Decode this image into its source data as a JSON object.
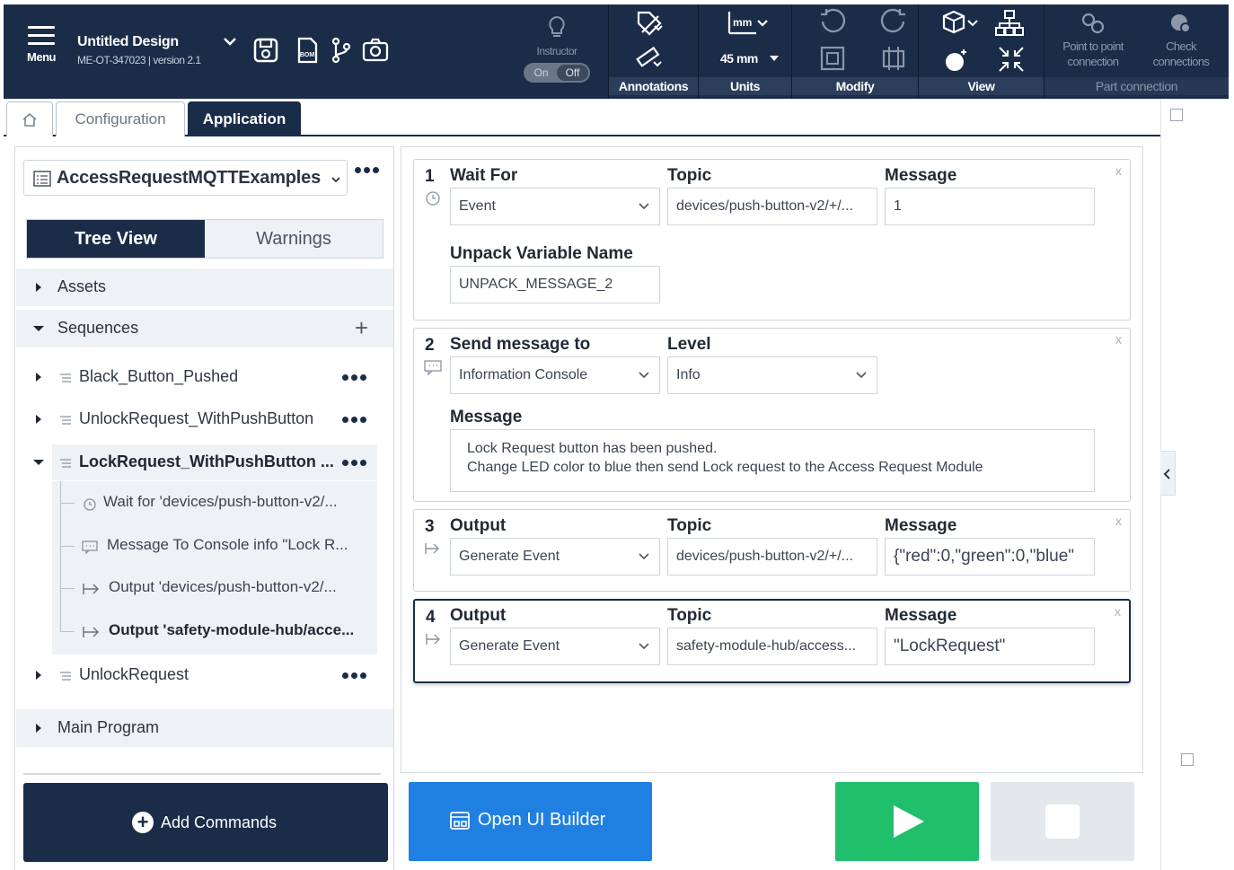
{
  "colors": {
    "navy": "#1b2c49",
    "blue": "#1f80e2",
    "green": "#20bf6b",
    "grey": "#e4e7eb"
  },
  "topbar": {
    "menu_label": "Menu",
    "design_title": "Untitled Design",
    "design_subtitle": "ME-OT-347023 | version 2.1",
    "tools": [
      "save-icon",
      "bom-icon",
      "branch-icon",
      "camera-icon"
    ],
    "instructor": {
      "label": "Instructor",
      "on": "On",
      "off": "Off"
    },
    "groups": {
      "annotations": "Annotations",
      "units": "Units",
      "units_value": "45 mm",
      "units_icon_text": "mm",
      "modify": "Modify",
      "view": "View",
      "part_connection": "Part connection"
    },
    "point_to_point": "Point to point connection",
    "check_connections": "Check connections"
  },
  "tabs": {
    "configuration": "Configuration",
    "application": "Application"
  },
  "left": {
    "program_name": "AccessRequestMQTTExamples",
    "views": {
      "tree": "Tree View",
      "warnings": "Warnings"
    },
    "sections": {
      "assets": "Assets",
      "sequences": "Sequences",
      "main_program": "Main Program"
    },
    "sequences": [
      {
        "label": "Black_Button_Pushed"
      },
      {
        "label": "UnlockRequest_WithPushButton"
      },
      {
        "label": "LockRequest_WithPushButton ..."
      },
      {
        "label": "UnlockRequest"
      }
    ],
    "sub_items": [
      {
        "label": "Wait for 'devices/push-button-v2/...",
        "icon": "clock-icon"
      },
      {
        "label": "Message To Console info \"Lock R...",
        "icon": "message-icon"
      },
      {
        "label": "Output 'devices/push-button-v2/...",
        "icon": "output-icon"
      },
      {
        "label": "Output 'safety-module-hub/acce...",
        "icon": "output-icon"
      }
    ],
    "add_commands": "Add Commands"
  },
  "cards": {
    "c1": {
      "num": "1",
      "wait_for_label": "Wait For",
      "wait_for_value": "Event",
      "topic_label": "Topic",
      "topic_value": "devices/push-button-v2/+/...",
      "message_label": "Message",
      "message_value": "1",
      "unpack_label": "Unpack Variable Name",
      "unpack_value": "UNPACK_MESSAGE_2"
    },
    "c2": {
      "num": "2",
      "send_label": "Send message to",
      "send_value": "Information Console",
      "level_label": "Level",
      "level_value": "Info",
      "message_label": "Message",
      "message_line1": "Lock Request button has been pushed.",
      "message_line2": "Change LED color to blue then send Lock request to the Access Request Module"
    },
    "c3": {
      "num": "3",
      "output_label": "Output",
      "output_value": "Generate Event",
      "topic_label": "Topic",
      "topic_value": "devices/push-button-v2/+/...",
      "message_label": "Message",
      "message_value": "{\"red\":0,\"green\":0,\"blue\""
    },
    "c4": {
      "num": "4",
      "output_label": "Output",
      "output_value": "Generate Event",
      "topic_label": "Topic",
      "topic_value": "safety-module-hub/access...",
      "message_label": "Message",
      "message_value": "\"LockRequest\""
    },
    "close": "x"
  },
  "bottom": {
    "ui_builder": "Open UI Builder"
  }
}
